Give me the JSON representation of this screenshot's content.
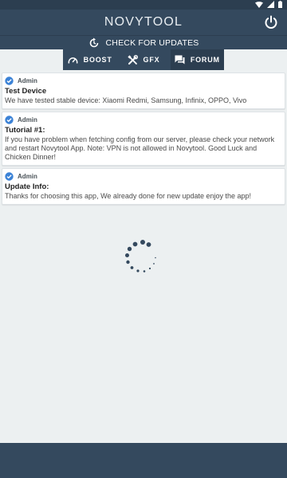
{
  "app": {
    "title": "NOVYTOOL"
  },
  "status_icons": [
    "wifi-icon",
    "signal-icon",
    "battery-icon"
  ],
  "update_bar": {
    "label": "CHECK FOR UPDATES",
    "icon": "refresh-icon"
  },
  "tabs": [
    {
      "label": "BOOST",
      "icon": "speedometer-icon",
      "active": false
    },
    {
      "label": "GFX",
      "icon": "tools-icon",
      "active": false
    },
    {
      "label": "FORUM",
      "icon": "chat-icon",
      "active": true
    }
  ],
  "posts": [
    {
      "author": "Admin",
      "title": "Test Device",
      "body": "We have tested stable device: Xiaomi Redmi, Samsung, Infinix, OPPO, Vivo"
    },
    {
      "author": "Admin",
      "title": "Tutorial #1:",
      "body": "If you have problem when fetching config from our server, please check your network and restart Novytool App. Note: VPN is not allowed in Novytool. Good Luck and Chicken Dinner!"
    },
    {
      "author": "Admin",
      "title": "Update Info:",
      "body": "Thanks for choosing this app, We already done for new update enjoy the app!"
    }
  ],
  "colors": {
    "header": "#34495e",
    "statusbar": "#2c3e50",
    "active_tab": "#2c3e50",
    "background": "#ecf0f1",
    "verified_badge": "#3b82d6"
  }
}
